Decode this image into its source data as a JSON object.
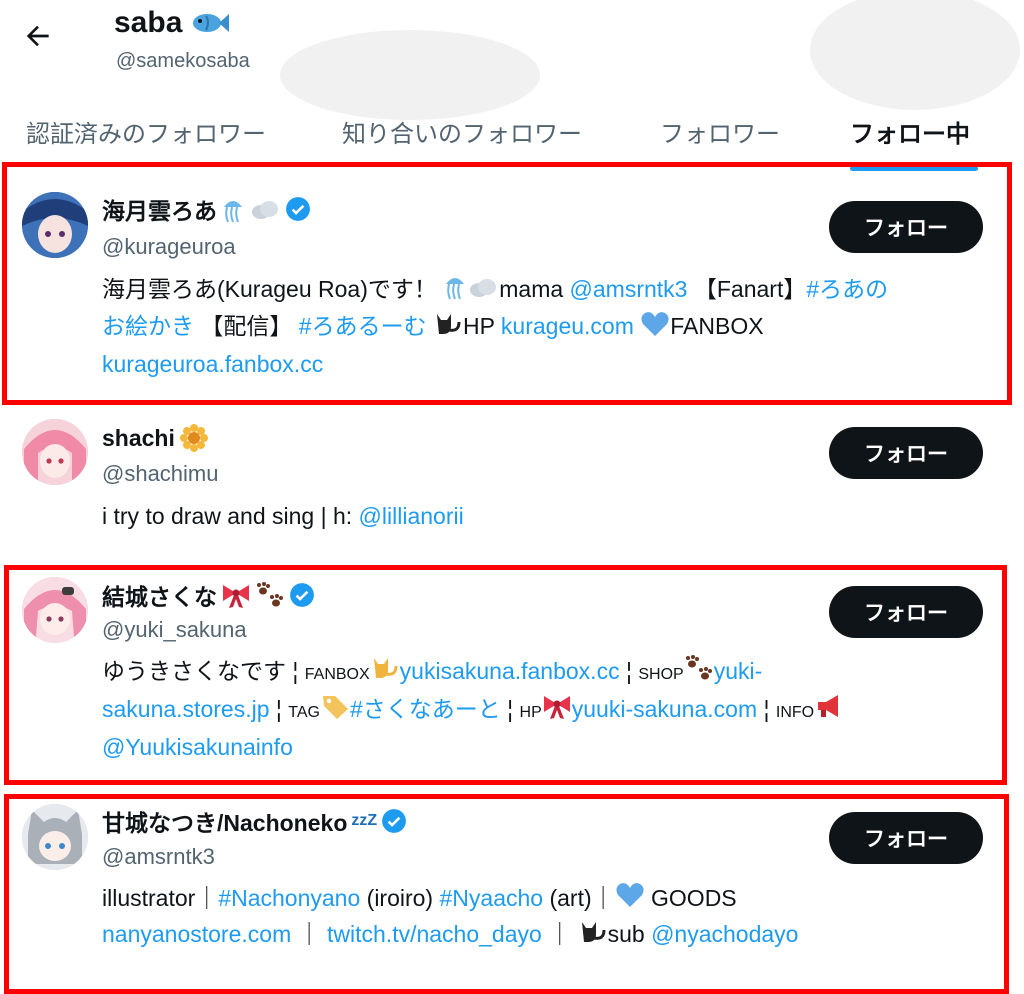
{
  "header": {
    "name": "saba",
    "handle": "@samekosaba"
  },
  "tabs": [
    "認証済みのフォロワー",
    "知り合いのフォロワー",
    "フォロワー",
    "フォロー中"
  ],
  "follow_label": "フォロー",
  "users": [
    {
      "name": "海月雲ろあ",
      "handle": "@kurageuroa",
      "bio": {
        "l1a": "海月雲ろあ(Kurageu Roa)です！ ",
        "l1b": "mama ",
        "l1c": "@amsrntk3",
        "l1d": " 【Fanart】",
        "l1e": "#ろあの",
        "l2a": "お絵かき",
        "l2b": " 【配信】 ",
        "l2c": "#ろあるーむ",
        "l2d": "HP ",
        "l2e": "kurageu.com",
        "l2f": "FANBOX",
        "l3a": "kurageuroa.fanbox.cc"
      }
    },
    {
      "name": "shachi",
      "handle": "@shachimu",
      "bio": {
        "l1a": "i try to draw and sing | h: ",
        "l1b": "@lillianorii"
      }
    },
    {
      "name": "結城さくな",
      "handle": "@yuki_sakuna",
      "bio": {
        "l1a": "ゆうきさくなです ¦ ",
        "l1b": "FANBOX",
        "l1c": "yukisakuna.fanbox.cc",
        "l1d": " ¦ ",
        "l1e": "SHOP",
        "l1f": "yuki-",
        "l2a": "sakuna.stores.jp",
        "l2b": " ¦ ",
        "l2c": "TAG",
        "l2d": "#さくなあーと",
        "l2e": " ¦ ",
        "l2f": "HP",
        "l2g": "yuuki-sakuna.com",
        "l2h": " ¦ ",
        "l2i": "INFO",
        "l3a": "@Yuukisakunainfo"
      }
    },
    {
      "name": "甘城なつき/Nachoneko",
      "name_suffix": "zzZ",
      "handle": "@amsrntk3",
      "bio": {
        "l1a": "illustrator｜",
        "l1b": "#Nachonyano",
        "l1c": " (iroiro) ",
        "l1d": "#Nyaacho",
        "l1e": " (art)｜",
        "l1f": " GOODS",
        "l2a": "nanyanostore.com",
        "l2b": " ｜ ",
        "l2c": "twitch.tv/nacho_dayo",
        "l2d": " ｜ ",
        "l2e": "sub ",
        "l2f": "@nyachodayo"
      }
    }
  ]
}
